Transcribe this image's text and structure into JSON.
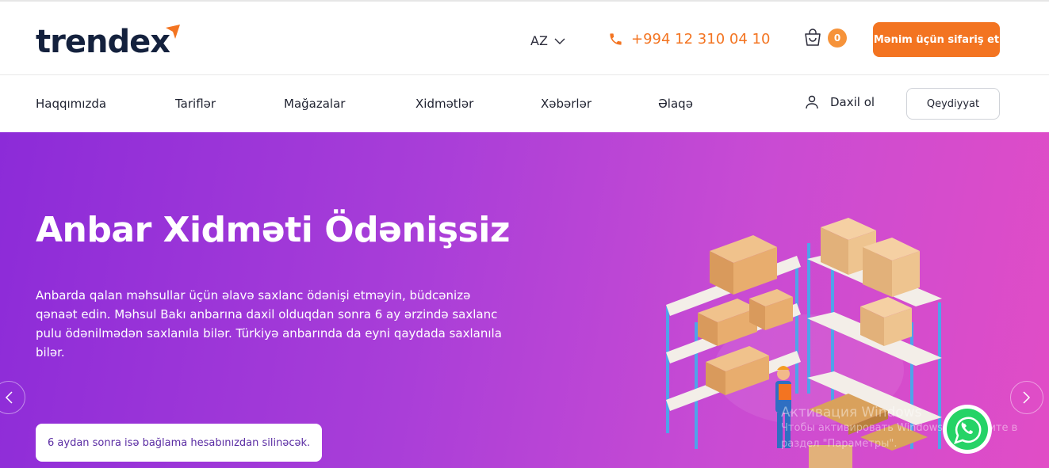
{
  "header": {
    "logo": "trendex",
    "language": "AZ",
    "phone": "+994 12 310 04 10",
    "cart_count": "0",
    "order_button": "Mənim üçün sifariş et",
    "brand_color": "#f37421"
  },
  "nav": {
    "items": [
      "Haqqımızda",
      "Tariflər",
      "Mağazalar",
      "Xidmətlər",
      "Xəbərlər",
      "Əlaqə"
    ],
    "login": "Daxil ol",
    "register": "Qeydiyyat"
  },
  "hero": {
    "title": "Anbar Xidməti Ödənişsiz",
    "text": "Anbarda qalan məhsullar üçün əlavə saxlanc ödənişi etməyin, büdcənizə qənaət edin. Məhsul Bakı anbarına daxil olduqdan sonra 6 ay ərzində saxlanc pulu ödənilmədən saxlanıla bilər. Türkiyə anbarında da eyni qaydada saxlanıla bilər.",
    "note": "6 aydan sonra isə bağlama hesabınızdan silinəcək.",
    "gradient_start": "#8c2bd8",
    "gradient_end": "#e14dc6"
  },
  "icons": {
    "logo_mark": "orange-arrow-icon",
    "language_chevron": "chevron-down-icon",
    "phone": "phone-icon",
    "cart": "cart-icon",
    "user": "user-icon",
    "prev": "chevron-left-icon",
    "next": "chevron-right-icon",
    "whatsapp": "whatsapp-icon"
  },
  "watermark": {
    "line1": "Активация Windows",
    "line2": "Чтобы активировать Windows, перейдите в",
    "line3": "раздел \"Параметры\"."
  }
}
